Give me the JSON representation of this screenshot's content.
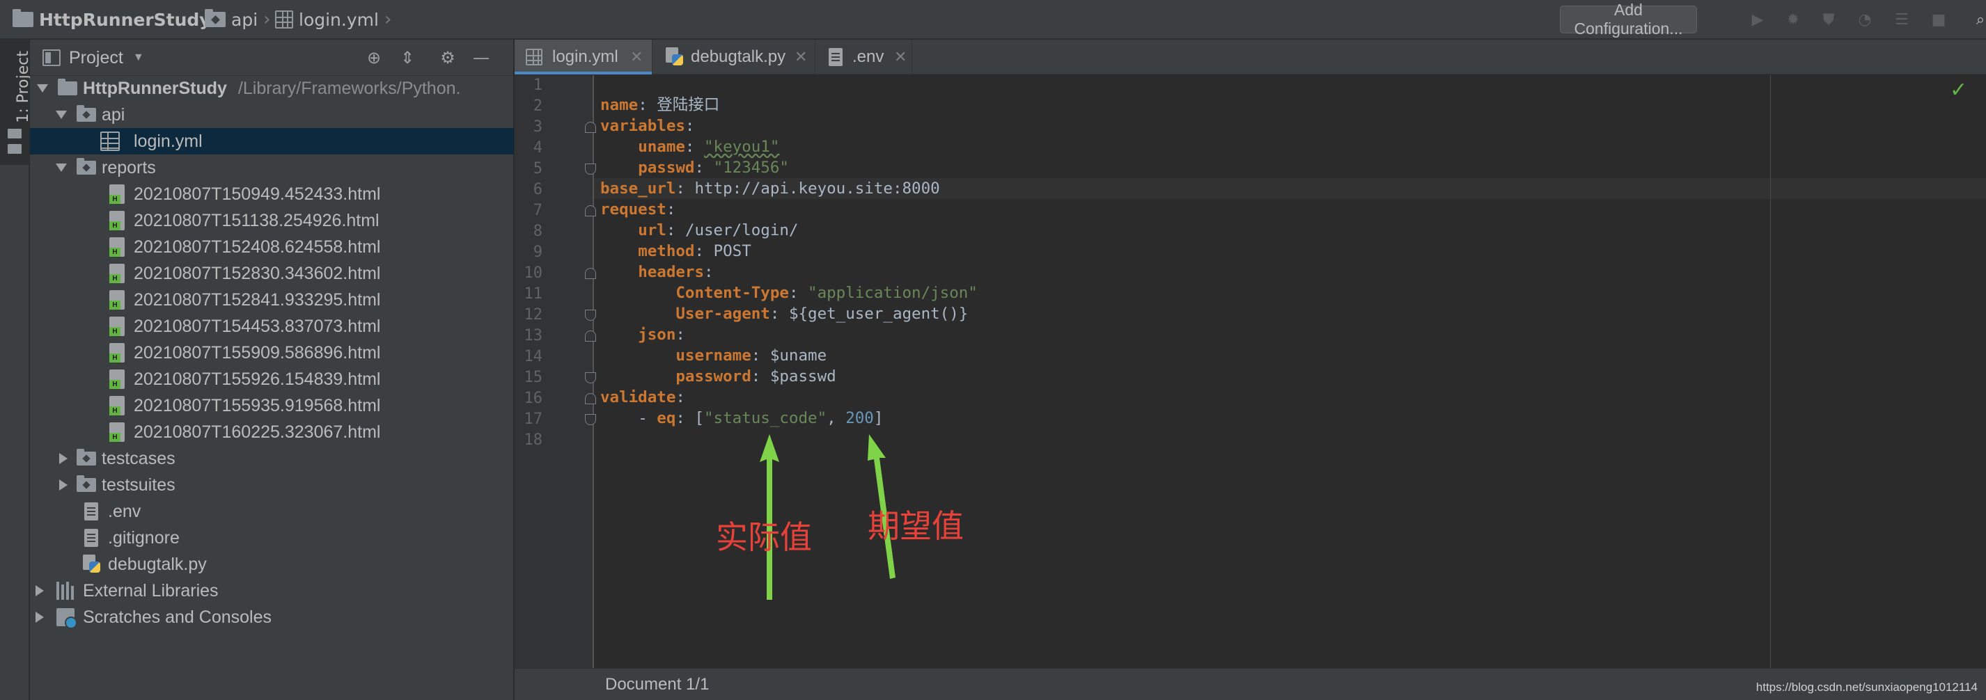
{
  "breadcrumb": {
    "items": [
      {
        "label": "HttpRunnerStudy",
        "icon": "folder-icon"
      },
      {
        "label": "api",
        "icon": "folder-icon"
      },
      {
        "label": "login.yml",
        "icon": "table-file-icon"
      }
    ]
  },
  "toolbar": {
    "add_configuration": "Add Configuration...",
    "icons": [
      "run-icon",
      "debug-icon",
      "coverage-icon",
      "profile-icon",
      "build-icon",
      "stop-icon",
      "search-icon"
    ]
  },
  "toolstrip": {
    "project_label": "1: Project"
  },
  "project_panel": {
    "title": "Project",
    "tree": [
      {
        "label": "HttpRunnerStudy",
        "path": "/Library/Frameworks/Python.",
        "icon": "folder-icon",
        "expanded": true
      },
      {
        "label": "api",
        "icon": "folder-icon",
        "expanded": true
      },
      {
        "label": "login.yml",
        "icon": "yaml-file-icon",
        "selected": true
      },
      {
        "label": "reports",
        "icon": "folder-icon",
        "expanded": true
      },
      {
        "label": "20210807T150949.452433.html",
        "icon": "html-file-icon"
      },
      {
        "label": "20210807T151138.254926.html",
        "icon": "html-file-icon"
      },
      {
        "label": "20210807T152408.624558.html",
        "icon": "html-file-icon"
      },
      {
        "label": "20210807T152830.343602.html",
        "icon": "html-file-icon"
      },
      {
        "label": "20210807T152841.933295.html",
        "icon": "html-file-icon"
      },
      {
        "label": "20210807T154453.837073.html",
        "icon": "html-file-icon"
      },
      {
        "label": "20210807T155909.586896.html",
        "icon": "html-file-icon"
      },
      {
        "label": "20210807T155926.154839.html",
        "icon": "html-file-icon"
      },
      {
        "label": "20210807T155935.919568.html",
        "icon": "html-file-icon"
      },
      {
        "label": "20210807T160225.323067.html",
        "icon": "html-file-icon"
      },
      {
        "label": "testcases",
        "icon": "folder-icon",
        "expanded": false
      },
      {
        "label": "testsuites",
        "icon": "folder-icon",
        "expanded": false
      },
      {
        "label": ".env",
        "icon": "text-file-icon"
      },
      {
        "label": ".gitignore",
        "icon": "text-file-icon"
      },
      {
        "label": "debugtalk.py",
        "icon": "python-file-icon"
      },
      {
        "label": "External Libraries",
        "icon": "library-icon",
        "expanded": false
      },
      {
        "label": "Scratches and Consoles",
        "icon": "scratches-icon",
        "expanded": false
      }
    ]
  },
  "tabs": [
    {
      "label": "login.yml",
      "active": true
    },
    {
      "label": "debugtalk.py",
      "active": false
    },
    {
      "label": ".env",
      "active": false
    }
  ],
  "editor": {
    "line_numbers": [
      "1",
      "2",
      "3",
      "4",
      "5",
      "6",
      "7",
      "8",
      "9",
      "10",
      "11",
      "12",
      "13",
      "14",
      "15",
      "16",
      "17",
      "18"
    ],
    "lines": {
      "l2_key": "name",
      "l2_val": "登陆接口",
      "l3_key": "variables",
      "l4_key": "uname",
      "l4_val": "\"keyou1\"",
      "l5_key": "passwd",
      "l5_val": "\"123456\"",
      "l6_key": "base_url",
      "l6_val": "http://api.keyou.site:8000",
      "l7_key": "request",
      "l8_key": "url",
      "l8_val": "/user/login/",
      "l9_key": "method",
      "l9_val": "POST",
      "l10_key": "headers",
      "l11_key": "Content-Type",
      "l11_val": "\"application/json\"",
      "l12_key": "User-agent",
      "l12_val": "${get_user_agent()}",
      "l13_key": "json",
      "l14_key": "username",
      "l14_val": "$uname",
      "l15_key": "password",
      "l15_val": "$passwd",
      "l16_key": "validate",
      "l17_dash": "- ",
      "l17_key": "eq",
      "l17_open": "[",
      "l17_str": "\"status_code\"",
      "l17_comma": ", ",
      "l17_num": "200",
      "l17_close": "]"
    }
  },
  "annotations": {
    "actual": "实际值",
    "expected": "期望值",
    "color": "#e8413a",
    "arrow_color": "#7ed348"
  },
  "status": {
    "document": "Document 1/1"
  },
  "watermark": "https://blog.csdn.net/sunxiaopeng1012114"
}
